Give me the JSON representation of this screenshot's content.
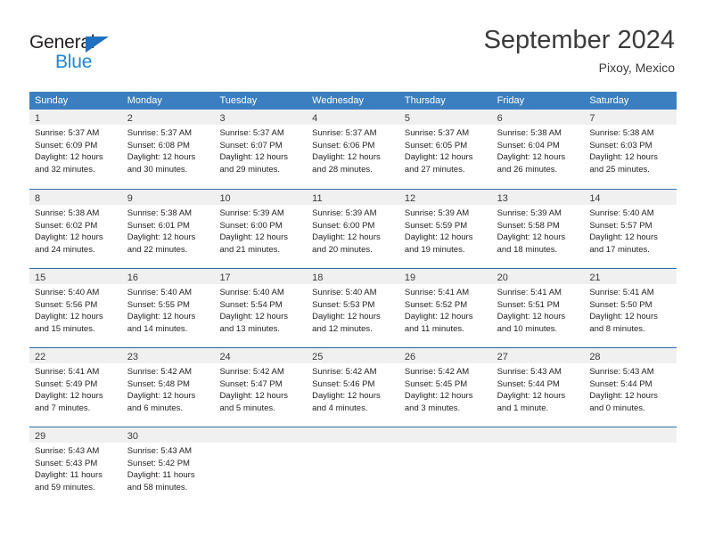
{
  "brand": {
    "name_part1": "General",
    "name_part2": "Blue",
    "triangle_color": "#1f70c1",
    "blue_text_color": "#1f86d4"
  },
  "header": {
    "title": "September 2024",
    "location": "Pixoy, Mexico"
  },
  "theme": {
    "header_blue": "#3c7fc0",
    "row_divider_blue": "#2e6ca6",
    "day_band_gray": "#f0f0f0",
    "text_color": "#231f20"
  },
  "weekdays": [
    "Sunday",
    "Monday",
    "Tuesday",
    "Wednesday",
    "Thursday",
    "Friday",
    "Saturday"
  ],
  "weeks": [
    [
      {
        "day": "1",
        "sunrise": "Sunrise: 5:37 AM",
        "sunset": "Sunset: 6:09 PM",
        "daylight1": "Daylight: 12 hours",
        "daylight2": "and 32 minutes."
      },
      {
        "day": "2",
        "sunrise": "Sunrise: 5:37 AM",
        "sunset": "Sunset: 6:08 PM",
        "daylight1": "Daylight: 12 hours",
        "daylight2": "and 30 minutes."
      },
      {
        "day": "3",
        "sunrise": "Sunrise: 5:37 AM",
        "sunset": "Sunset: 6:07 PM",
        "daylight1": "Daylight: 12 hours",
        "daylight2": "and 29 minutes."
      },
      {
        "day": "4",
        "sunrise": "Sunrise: 5:37 AM",
        "sunset": "Sunset: 6:06 PM",
        "daylight1": "Daylight: 12 hours",
        "daylight2": "and 28 minutes."
      },
      {
        "day": "5",
        "sunrise": "Sunrise: 5:37 AM",
        "sunset": "Sunset: 6:05 PM",
        "daylight1": "Daylight: 12 hours",
        "daylight2": "and 27 minutes."
      },
      {
        "day": "6",
        "sunrise": "Sunrise: 5:38 AM",
        "sunset": "Sunset: 6:04 PM",
        "daylight1": "Daylight: 12 hours",
        "daylight2": "and 26 minutes."
      },
      {
        "day": "7",
        "sunrise": "Sunrise: 5:38 AM",
        "sunset": "Sunset: 6:03 PM",
        "daylight1": "Daylight: 12 hours",
        "daylight2": "and 25 minutes."
      }
    ],
    [
      {
        "day": "8",
        "sunrise": "Sunrise: 5:38 AM",
        "sunset": "Sunset: 6:02 PM",
        "daylight1": "Daylight: 12 hours",
        "daylight2": "and 24 minutes."
      },
      {
        "day": "9",
        "sunrise": "Sunrise: 5:38 AM",
        "sunset": "Sunset: 6:01 PM",
        "daylight1": "Daylight: 12 hours",
        "daylight2": "and 22 minutes."
      },
      {
        "day": "10",
        "sunrise": "Sunrise: 5:39 AM",
        "sunset": "Sunset: 6:00 PM",
        "daylight1": "Daylight: 12 hours",
        "daylight2": "and 21 minutes."
      },
      {
        "day": "11",
        "sunrise": "Sunrise: 5:39 AM",
        "sunset": "Sunset: 6:00 PM",
        "daylight1": "Daylight: 12 hours",
        "daylight2": "and 20 minutes."
      },
      {
        "day": "12",
        "sunrise": "Sunrise: 5:39 AM",
        "sunset": "Sunset: 5:59 PM",
        "daylight1": "Daylight: 12 hours",
        "daylight2": "and 19 minutes."
      },
      {
        "day": "13",
        "sunrise": "Sunrise: 5:39 AM",
        "sunset": "Sunset: 5:58 PM",
        "daylight1": "Daylight: 12 hours",
        "daylight2": "and 18 minutes."
      },
      {
        "day": "14",
        "sunrise": "Sunrise: 5:40 AM",
        "sunset": "Sunset: 5:57 PM",
        "daylight1": "Daylight: 12 hours",
        "daylight2": "and 17 minutes."
      }
    ],
    [
      {
        "day": "15",
        "sunrise": "Sunrise: 5:40 AM",
        "sunset": "Sunset: 5:56 PM",
        "daylight1": "Daylight: 12 hours",
        "daylight2": "and 15 minutes."
      },
      {
        "day": "16",
        "sunrise": "Sunrise: 5:40 AM",
        "sunset": "Sunset: 5:55 PM",
        "daylight1": "Daylight: 12 hours",
        "daylight2": "and 14 minutes."
      },
      {
        "day": "17",
        "sunrise": "Sunrise: 5:40 AM",
        "sunset": "Sunset: 5:54 PM",
        "daylight1": "Daylight: 12 hours",
        "daylight2": "and 13 minutes."
      },
      {
        "day": "18",
        "sunrise": "Sunrise: 5:40 AM",
        "sunset": "Sunset: 5:53 PM",
        "daylight1": "Daylight: 12 hours",
        "daylight2": "and 12 minutes."
      },
      {
        "day": "19",
        "sunrise": "Sunrise: 5:41 AM",
        "sunset": "Sunset: 5:52 PM",
        "daylight1": "Daylight: 12 hours",
        "daylight2": "and 11 minutes."
      },
      {
        "day": "20",
        "sunrise": "Sunrise: 5:41 AM",
        "sunset": "Sunset: 5:51 PM",
        "daylight1": "Daylight: 12 hours",
        "daylight2": "and 10 minutes."
      },
      {
        "day": "21",
        "sunrise": "Sunrise: 5:41 AM",
        "sunset": "Sunset: 5:50 PM",
        "daylight1": "Daylight: 12 hours",
        "daylight2": "and 8 minutes."
      }
    ],
    [
      {
        "day": "22",
        "sunrise": "Sunrise: 5:41 AM",
        "sunset": "Sunset: 5:49 PM",
        "daylight1": "Daylight: 12 hours",
        "daylight2": "and 7 minutes."
      },
      {
        "day": "23",
        "sunrise": "Sunrise: 5:42 AM",
        "sunset": "Sunset: 5:48 PM",
        "daylight1": "Daylight: 12 hours",
        "daylight2": "and 6 minutes."
      },
      {
        "day": "24",
        "sunrise": "Sunrise: 5:42 AM",
        "sunset": "Sunset: 5:47 PM",
        "daylight1": "Daylight: 12 hours",
        "daylight2": "and 5 minutes."
      },
      {
        "day": "25",
        "sunrise": "Sunrise: 5:42 AM",
        "sunset": "Sunset: 5:46 PM",
        "daylight1": "Daylight: 12 hours",
        "daylight2": "and 4 minutes."
      },
      {
        "day": "26",
        "sunrise": "Sunrise: 5:42 AM",
        "sunset": "Sunset: 5:45 PM",
        "daylight1": "Daylight: 12 hours",
        "daylight2": "and 3 minutes."
      },
      {
        "day": "27",
        "sunrise": "Sunrise: 5:43 AM",
        "sunset": "Sunset: 5:44 PM",
        "daylight1": "Daylight: 12 hours",
        "daylight2": "and 1 minute."
      },
      {
        "day": "28",
        "sunrise": "Sunrise: 5:43 AM",
        "sunset": "Sunset: 5:44 PM",
        "daylight1": "Daylight: 12 hours",
        "daylight2": "and 0 minutes."
      }
    ],
    [
      {
        "day": "29",
        "sunrise": "Sunrise: 5:43 AM",
        "sunset": "Sunset: 5:43 PM",
        "daylight1": "Daylight: 11 hours",
        "daylight2": "and 59 minutes."
      },
      {
        "day": "30",
        "sunrise": "Sunrise: 5:43 AM",
        "sunset": "Sunset: 5:42 PM",
        "daylight1": "Daylight: 11 hours",
        "daylight2": "and 58 minutes."
      },
      {
        "day": "",
        "sunrise": "",
        "sunset": "",
        "daylight1": "",
        "daylight2": ""
      },
      {
        "day": "",
        "sunrise": "",
        "sunset": "",
        "daylight1": "",
        "daylight2": ""
      },
      {
        "day": "",
        "sunrise": "",
        "sunset": "",
        "daylight1": "",
        "daylight2": ""
      },
      {
        "day": "",
        "sunrise": "",
        "sunset": "",
        "daylight1": "",
        "daylight2": ""
      },
      {
        "day": "",
        "sunrise": "",
        "sunset": "",
        "daylight1": "",
        "daylight2": ""
      }
    ]
  ]
}
